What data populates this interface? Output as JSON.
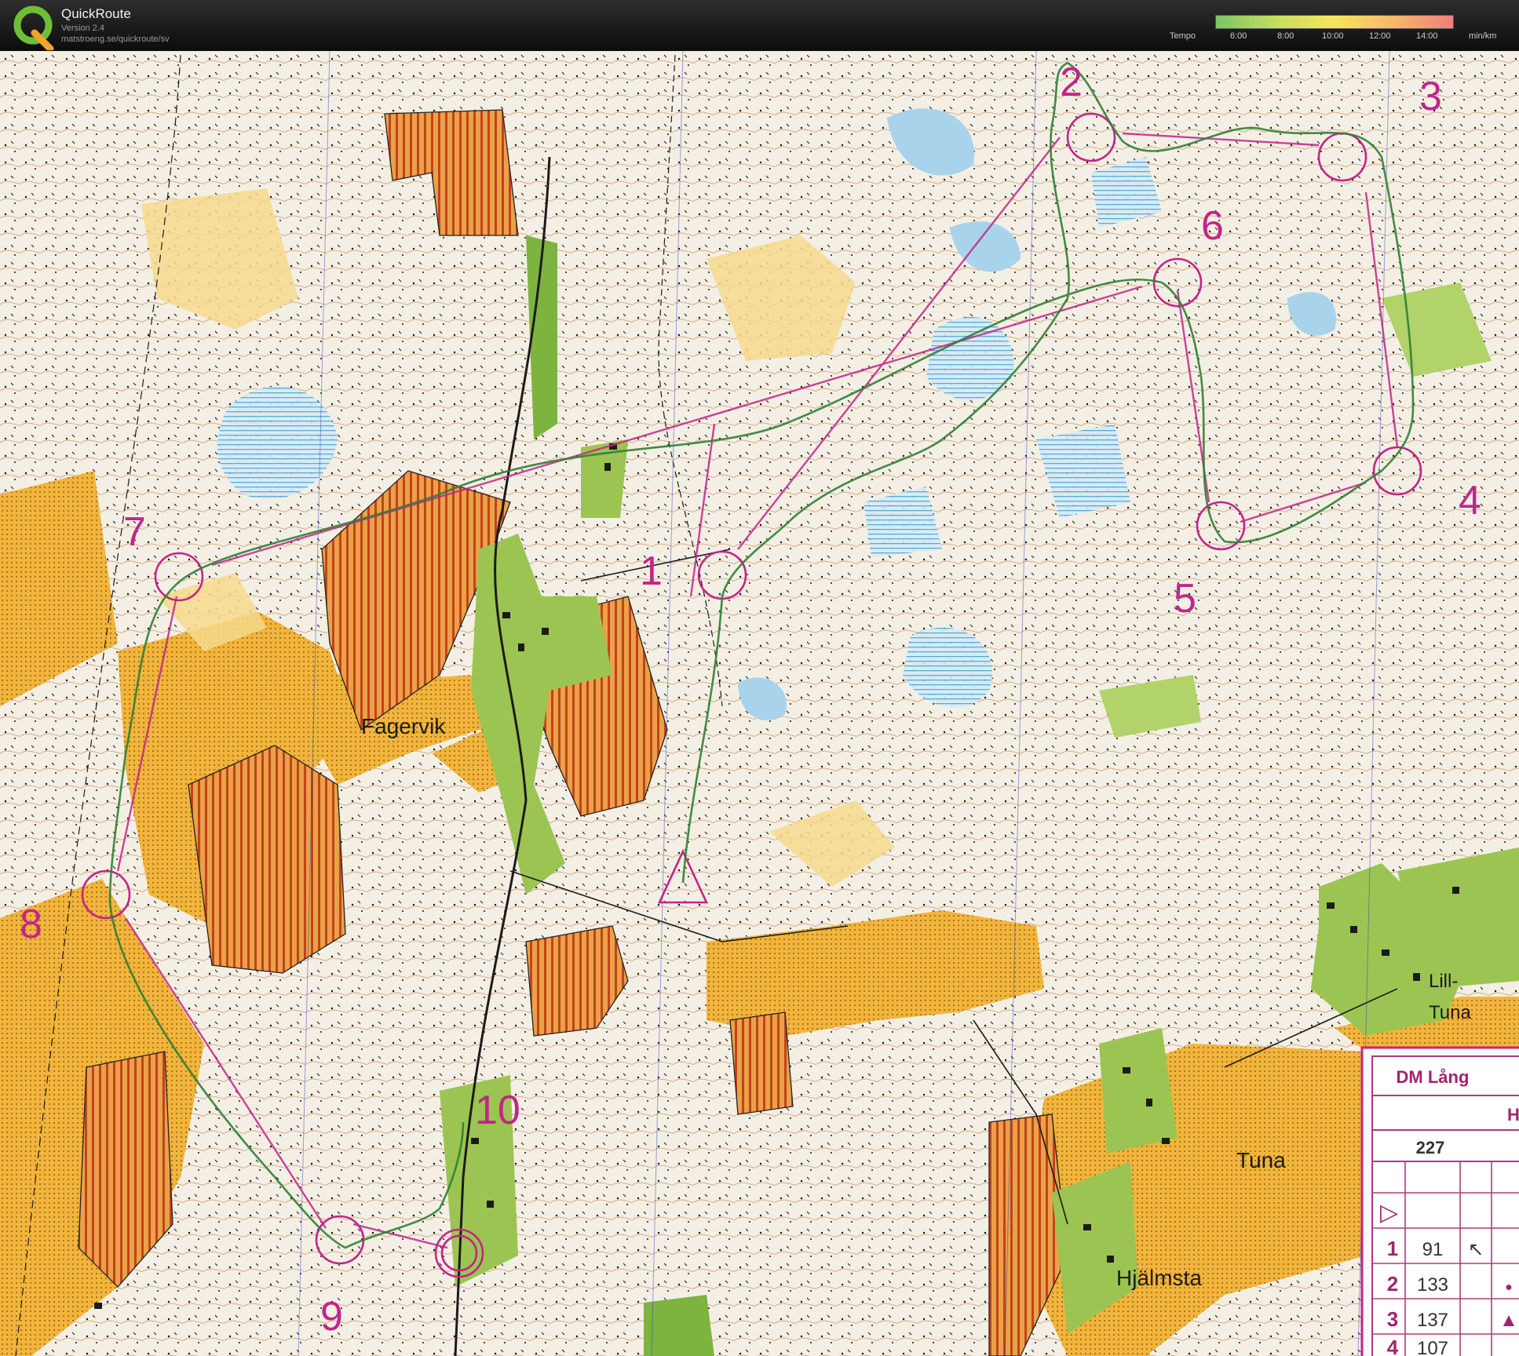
{
  "app": {
    "title": "QuickRoute",
    "version": "Version 2.4",
    "url": "matstroeng.se/quickroute/sv",
    "logo_letter": "Q",
    "logo_icon": "quickroute-q-logo-icon"
  },
  "legend": {
    "title": "Tempo",
    "ticks": [
      "6:00",
      "8:00",
      "10:00",
      "12:00",
      "14:00"
    ],
    "unit": "min/km",
    "gradient": [
      "#7cc466",
      "#c5de60",
      "#f5e65c",
      "#f6b96a",
      "#f07e7e"
    ]
  },
  "map": {
    "colors": {
      "open": "#f2b43a",
      "rough_open": "#f6d98c",
      "field": "#e9a247",
      "green": "#b2d26a",
      "dark_green": "#7db43f",
      "marsh_blue": "#a9d3ea",
      "contour": "#b97742",
      "course": "#c2258a",
      "route": "#2e8034"
    },
    "place_names": [
      "Fagervik",
      "Lill-",
      "Tuna",
      "Tuna",
      "Hjälmsta"
    ],
    "control_numbers": [
      "1",
      "2",
      "3",
      "4",
      "5",
      "6",
      "7",
      "8",
      "9",
      "10"
    ]
  },
  "control_description": {
    "title": "DM Lång",
    "class": "H",
    "code": "227",
    "rows": [
      {
        "num": "1",
        "code": "91",
        "symbol": "↖"
      },
      {
        "num": "2",
        "code": "133",
        "symbol": "●"
      },
      {
        "num": "3",
        "code": "137",
        "symbol": "▲"
      },
      {
        "num": "4",
        "code": "107",
        "symbol": ""
      }
    ],
    "start_symbol": "▷"
  }
}
